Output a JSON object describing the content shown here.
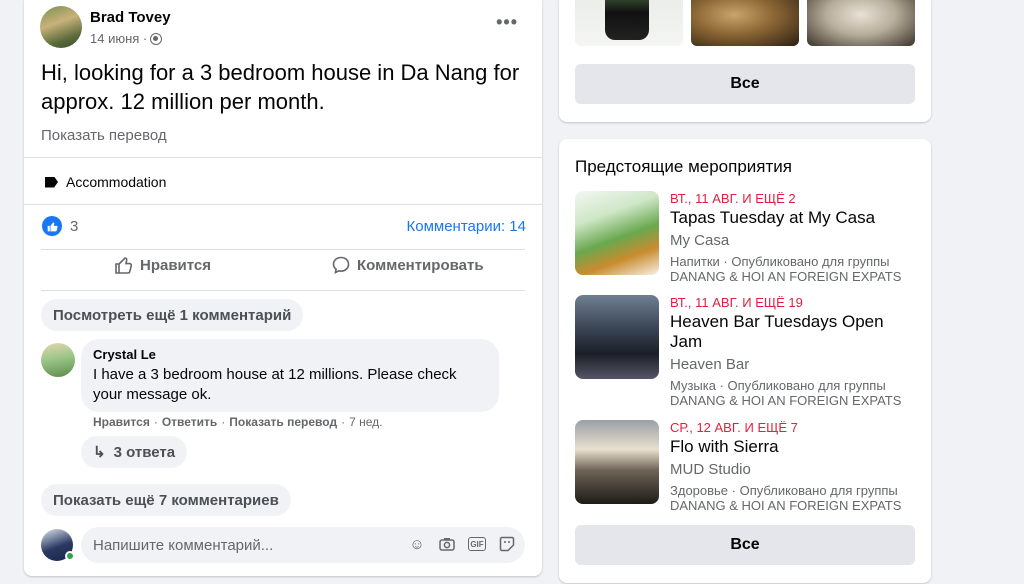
{
  "post": {
    "author": "Brad Tovey",
    "date": "14 июня · ",
    "text": "Hi, looking for a 3 bedroom house in Da Nang for approx. 12 million per month.",
    "translate_label": "Показать перевод",
    "tag": "Accommodation",
    "likes_count": "3",
    "comments_label": "Комментарии: 14",
    "like_action": "Нравится",
    "comment_action": "Комментировать",
    "view_more_label": "Посмотреть ещё 1 комментарий",
    "show_more_label": "Показать ещё 7 комментариев",
    "comment": {
      "author": "Crystal Le",
      "text": "I have a 3 bedroom house at 12 millions. Please check your message ok.",
      "like": "Нравится",
      "reply": "Ответить",
      "translate": "Показать перевод",
      "time": "7 нед.",
      "replies_label": "3 ответа"
    },
    "comment_placeholder": "Напишите комментарий..."
  },
  "sidebar": {
    "photos_all_label": "Все",
    "events_heading": "Предстоящие мероприятия",
    "events": [
      {
        "date": "ВТ., 11 АВГ. И ЕЩЁ 2",
        "title": "Tapas Tuesday at My Casa",
        "venue": "My Casa",
        "category": "Напитки · Опубликовано для группы",
        "group": "DANANG & HOI AN FOREIGN EXPATS"
      },
      {
        "date": "ВТ., 11 АВГ. И ЕЩЁ 19",
        "title": "Heaven Bar Tuesdays Open Jam",
        "venue": "Heaven Bar",
        "category": "Музыка · Опубликовано для группы",
        "group": "DANANG & HOI AN FOREIGN EXPATS"
      },
      {
        "date": "СР., 12 АВГ. И ЕЩЁ 7",
        "title": "Flo with Sierra",
        "venue": "MUD Studio",
        "category": "Здоровье · Опубликовано для группы",
        "group": "DANANG & HOI AN FOREIGN EXPATS"
      }
    ],
    "events_all_label": "Все"
  },
  "colors": {
    "accent": "#1877f2",
    "event_date": "#e41e3f",
    "secondary_text": "#65676b",
    "background": "#f0f2f5"
  },
  "icons": [
    "globe-icon",
    "more-icon",
    "tag-icon",
    "like-reaction-icon",
    "thumbs-up-icon",
    "comment-icon",
    "reply-arrow-icon",
    "emoji-icon",
    "camera-icon",
    "gif-icon",
    "sticker-icon"
  ]
}
